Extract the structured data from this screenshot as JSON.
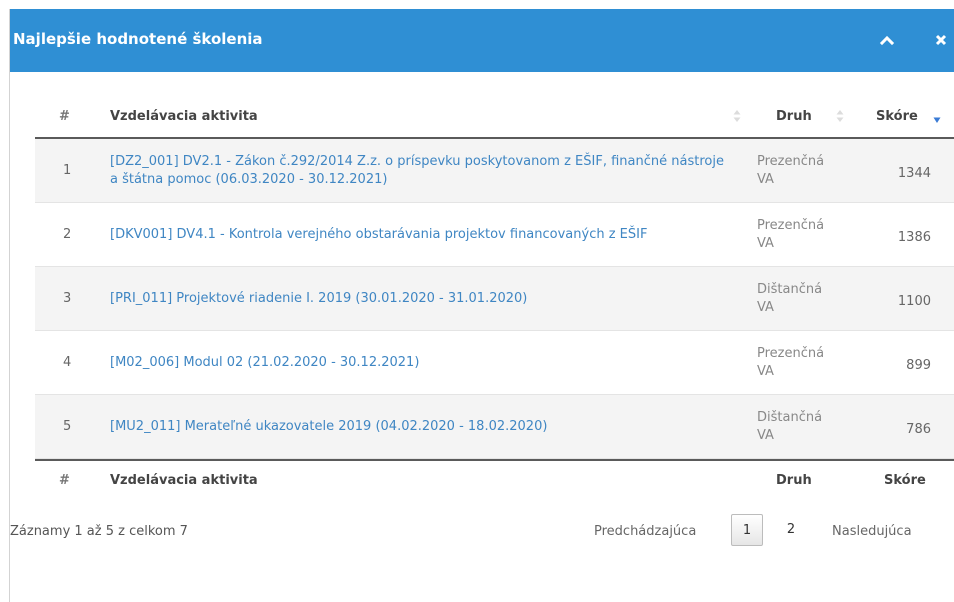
{
  "panel": {
    "title": "Najlepšie hodnotené školenia",
    "icons": {
      "collapse": "chevron-up-icon",
      "close": "close-icon"
    },
    "header_color": "#2f8fd4"
  },
  "table": {
    "columns": {
      "num": "#",
      "activity": "Vzdelávacia aktivita",
      "type": "Druh",
      "score": "Skóre"
    },
    "sort": {
      "column": "score",
      "direction": "descending",
      "accent": "#3a7bd5"
    },
    "rows": [
      {
        "num": "1",
        "activity": "[DZ2_001] DV2.1 - Zákon č.292/2014 Z.z. o príspevku poskytovanom z EŠIF, finančné nástroje a štátna pomoc (06.03.2020 - 30.12.2021)",
        "type": "Prezenčná VA",
        "score": "1344"
      },
      {
        "num": "2",
        "activity": "[DKV001] DV4.1 - Kontrola verejného obstarávania projektov financovaných z EŠIF",
        "type": "Prezenčná VA",
        "score": "1386"
      },
      {
        "num": "3",
        "activity": "[PRI_011] Projektové riadenie I. 2019 (30.01.2020 - 31.01.2020)",
        "type": "Dištančná VA",
        "score": "1100"
      },
      {
        "num": "4",
        "activity": "[M02_006] Modul 02 (21.02.2020 - 30.12.2021)",
        "type": "Prezenčná VA",
        "score": "899"
      },
      {
        "num": "5",
        "activity": "[MU2_011] Merateľné ukazovatele 2019 (04.02.2020 - 18.02.2020)",
        "type": "Dištančná VA",
        "score": "786"
      }
    ]
  },
  "footer": {
    "info": "Záznamy 1 až 5 z celkom 7",
    "prev": "Predchádzajúca",
    "pages": [
      "1",
      "2"
    ],
    "current_page": "1",
    "next": "Nasledujúca"
  }
}
